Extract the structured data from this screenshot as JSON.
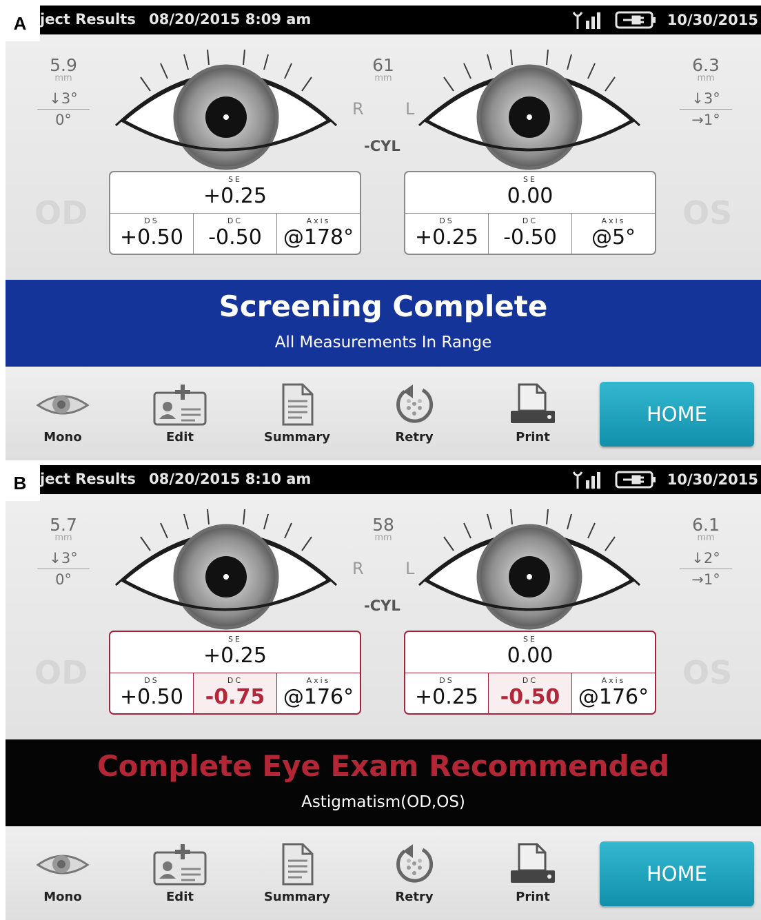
{
  "panels": [
    {
      "letter": "A",
      "status": {
        "title": "ject Results",
        "datetime": "08/20/2015 8:09 am",
        "date": "10/30/2015"
      },
      "right_eye": {
        "pupil_mm": "5.9",
        "unit": "mm",
        "tilt_v": "↓3°",
        "tilt_h": "0°",
        "label": "OD",
        "rx": {
          "se": "+0.25",
          "ds": "+0.50",
          "dc": "-0.50",
          "axis": "@178°"
        }
      },
      "left_eye": {
        "pupil_mm": "6.3",
        "unit": "mm",
        "tilt_v": "↓3°",
        "tilt_h": "→1°",
        "label": "OS",
        "rx": {
          "se": "0.00",
          "ds": "+0.25",
          "dc": "-0.50",
          "axis": "@5°"
        }
      },
      "pd": "61",
      "pd_unit": "mm",
      "r_label": "R",
      "l_label": "L",
      "cyl_label": "-CYL",
      "captions": {
        "se": "SE",
        "ds": "DS",
        "dc": "DC",
        "axis": "Axis"
      },
      "banner": {
        "main": "Screening Complete",
        "sub": "All Measurements In Range",
        "color": "#15349a"
      },
      "toolbar": {
        "mono": "Mono",
        "edit": "Edit",
        "summary": "Summary",
        "retry": "Retry",
        "print": "Print",
        "home": "HOME"
      }
    },
    {
      "letter": "B",
      "status": {
        "title": "ject Results",
        "datetime": "08/20/2015 8:10 am",
        "date": "10/30/2015"
      },
      "right_eye": {
        "pupil_mm": "5.7",
        "unit": "mm",
        "tilt_v": "↓3°",
        "tilt_h": "0°",
        "label": "OD",
        "rx": {
          "se": "+0.25",
          "ds": "+0.50",
          "dc": "-0.75",
          "axis": "@176°"
        }
      },
      "left_eye": {
        "pupil_mm": "6.1",
        "unit": "mm",
        "tilt_v": "↓2°",
        "tilt_h": "→1°",
        "label": "OS",
        "rx": {
          "se": "0.00",
          "ds": "+0.25",
          "dc": "-0.50",
          "axis": "@176°"
        }
      },
      "pd": "58",
      "pd_unit": "mm",
      "r_label": "R",
      "l_label": "L",
      "cyl_label": "-CYL",
      "captions": {
        "se": "SE",
        "ds": "DS",
        "dc": "DC",
        "axis": "Axis"
      },
      "banner": {
        "main": "Complete Eye Exam Recommended",
        "sub": "Astigmatism(OD,OS)",
        "color": "#b32636"
      },
      "toolbar": {
        "mono": "Mono",
        "edit": "Edit",
        "summary": "Summary",
        "retry": "Retry",
        "print": "Print",
        "home": "HOME"
      }
    }
  ],
  "icons": [
    "signal-icon",
    "battery-icon",
    "eye-icon",
    "mono-eye-icon",
    "edit-card-icon",
    "summary-document-icon",
    "retry-icon",
    "printer-icon"
  ]
}
